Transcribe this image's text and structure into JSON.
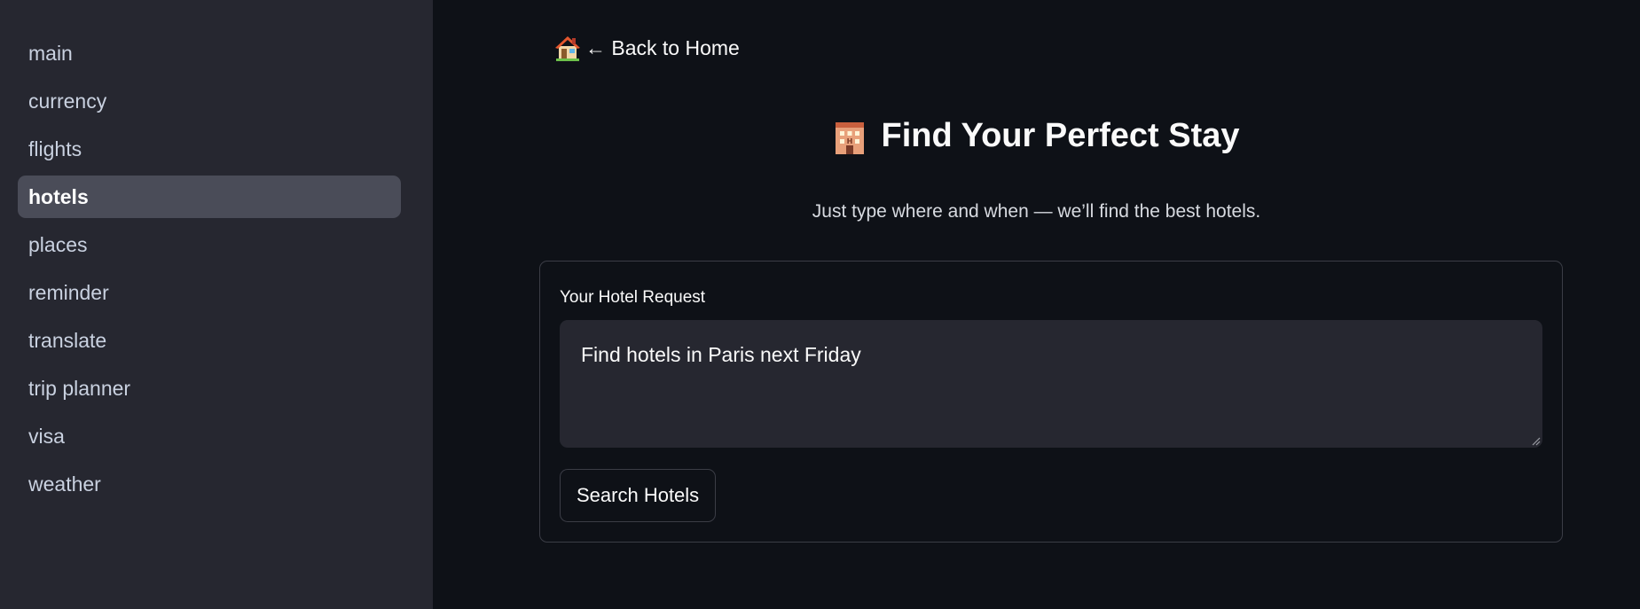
{
  "sidebar": {
    "items": [
      {
        "label": "main"
      },
      {
        "label": "currency"
      },
      {
        "label": "flights"
      },
      {
        "label": "hotels"
      },
      {
        "label": "places"
      },
      {
        "label": "reminder"
      },
      {
        "label": "translate"
      },
      {
        "label": "trip planner"
      },
      {
        "label": "visa"
      },
      {
        "label": "weather"
      }
    ],
    "active": "hotels"
  },
  "main": {
    "back_link": {
      "icon": "house-icon",
      "label": "← Back to Home"
    },
    "title": {
      "icon": "hotel-icon",
      "text": "Find Your Perfect Stay"
    },
    "subtitle": "Just type where and when — we’ll find the best hotels.",
    "form": {
      "label": "Your Hotel Request",
      "value": "Find hotels in Paris next Friday",
      "button_label": "Search Hotels"
    }
  },
  "colors": {
    "background": "#0e1117",
    "sidebar": "#262730",
    "active_item": "#4a4c58",
    "input_bg": "#262730",
    "border": "#3b3d46"
  }
}
